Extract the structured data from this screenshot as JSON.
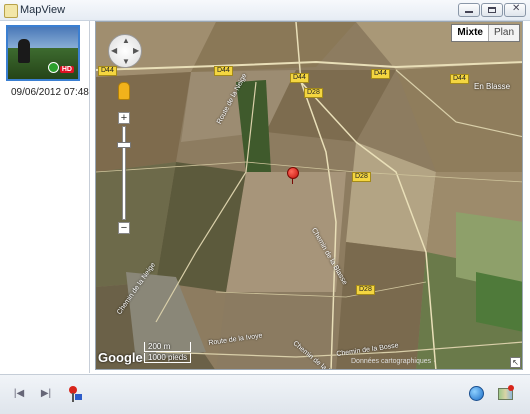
{
  "window": {
    "title": "MapView"
  },
  "sidebar": {
    "items": [
      {
        "date": "09/06/2012 07:48",
        "badge": "HD"
      }
    ]
  },
  "map": {
    "maptype": {
      "selected": "Mixte",
      "other": "Plan"
    },
    "labels": {
      "d44_a": "D44",
      "d44_b": "D44",
      "d44_c": "D44",
      "d44_d": "D44",
      "d44_e": "D44",
      "d28_a": "D28",
      "d28_b": "D28",
      "d28_c": "D28",
      "place": "En Blasse",
      "route_neige": "Route de la Neige",
      "chemin_blasse": "Chemin de la Blasse",
      "chemin_neige": "Chemin de la Neige",
      "route_ivoye": "Route de la Ivoye",
      "chemin_rivoye": "Chemin de la Rivoye",
      "chemin_bosse": "Chemin de la Bosse"
    },
    "scale": {
      "metric": "200 m",
      "imperial": "1000 pieds"
    },
    "logo": "Google",
    "credits": "Données cartographiques ·",
    "controls": {
      "zoom_in": "+",
      "zoom_out": "−"
    }
  },
  "colors": {
    "accent": "#3b7fd1",
    "marker": "#d8251b"
  }
}
